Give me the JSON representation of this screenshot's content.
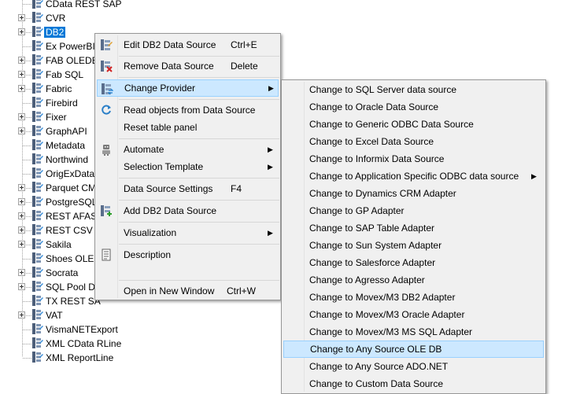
{
  "tree": {
    "items": [
      {
        "label": "CData REST SAP",
        "expandable": false
      },
      {
        "label": "CVR",
        "expandable": true
      },
      {
        "label": "DB2",
        "expandable": true,
        "selected": true
      },
      {
        "label": "Ex PowerBIT",
        "expandable": false
      },
      {
        "label": "FAB OLEDB",
        "expandable": true
      },
      {
        "label": "Fab SQL",
        "expandable": true
      },
      {
        "label": "Fabric",
        "expandable": true
      },
      {
        "label": "Firebird",
        "expandable": false
      },
      {
        "label": "Fixer",
        "expandable": true
      },
      {
        "label": "GraphAPI",
        "expandable": true
      },
      {
        "label": "Metadata",
        "expandable": false
      },
      {
        "label": "Northwind",
        "expandable": false
      },
      {
        "label": "OrigExDatasc",
        "expandable": false
      },
      {
        "label": "Parquet CMo",
        "expandable": true
      },
      {
        "label": "PostgreSQL",
        "expandable": true
      },
      {
        "label": "REST AFAS",
        "expandable": true
      },
      {
        "label": "REST CSV",
        "expandable": true
      },
      {
        "label": "Sakila",
        "expandable": true
      },
      {
        "label": "Shoes OLED",
        "expandable": false
      },
      {
        "label": "Socrata",
        "expandable": true
      },
      {
        "label": "SQL Pool DE",
        "expandable": true
      },
      {
        "label": "TX REST SA",
        "expandable": false
      },
      {
        "label": "VAT",
        "expandable": true
      },
      {
        "label": "VismaNETExport",
        "expandable": false
      },
      {
        "label": "XML CData RLine",
        "expandable": false
      },
      {
        "label": "XML ReportLine",
        "expandable": false
      }
    ]
  },
  "context_menu": {
    "edit": {
      "label": "Edit DB2 Data Source",
      "shortcut": "Ctrl+E"
    },
    "remove": {
      "label": "Remove Data Source",
      "shortcut": "Delete"
    },
    "change_provider": {
      "label": "Change Provider"
    },
    "read_objects": {
      "label": "Read objects from Data Source"
    },
    "reset_table": {
      "label": "Reset table panel"
    },
    "automate": {
      "label": "Automate"
    },
    "selection_template": {
      "label": "Selection Template"
    },
    "settings": {
      "label": "Data Source Settings",
      "shortcut": "F4"
    },
    "add": {
      "label": "Add DB2 Data Source"
    },
    "visualization": {
      "label": "Visualization"
    },
    "description": {
      "label": "Description"
    },
    "open_new_window": {
      "label": "Open in New Window",
      "shortcut": "Ctrl+W"
    }
  },
  "submenu": {
    "items": [
      {
        "label": "Change to SQL Server data source"
      },
      {
        "label": "Change to Oracle Data Source"
      },
      {
        "label": "Change to Generic ODBC Data Source"
      },
      {
        "label": "Change to Excel Data Source"
      },
      {
        "label": "Change to Informix Data Source"
      },
      {
        "label": "Change to Application Specific ODBC data source",
        "has_submenu": true
      },
      {
        "label": "Change to Dynamics CRM Adapter"
      },
      {
        "label": "Change to GP Adapter"
      },
      {
        "label": "Change to SAP Table Adapter"
      },
      {
        "label": "Change to Sun System Adapter"
      },
      {
        "label": "Change to Salesforce Adapter"
      },
      {
        "label": "Change to Agresso Adapter"
      },
      {
        "label": "Change to Movex/M3 DB2 Adapter"
      },
      {
        "label": "Change to Movex/M3 Oracle Adapter"
      },
      {
        "label": "Change to Movex/M3 MS SQL Adapter"
      },
      {
        "label": "Change to Any Source OLE DB",
        "highlighted": true
      },
      {
        "label": "Change to Any Source ADO.NET"
      },
      {
        "label": "Change to Custom Data Source"
      }
    ]
  },
  "colors": {
    "selection": "#0078d7",
    "menu_highlight": "#cce8ff",
    "menu_highlight_border": "#99d1ff",
    "menu_background": "#f0f0f0"
  }
}
